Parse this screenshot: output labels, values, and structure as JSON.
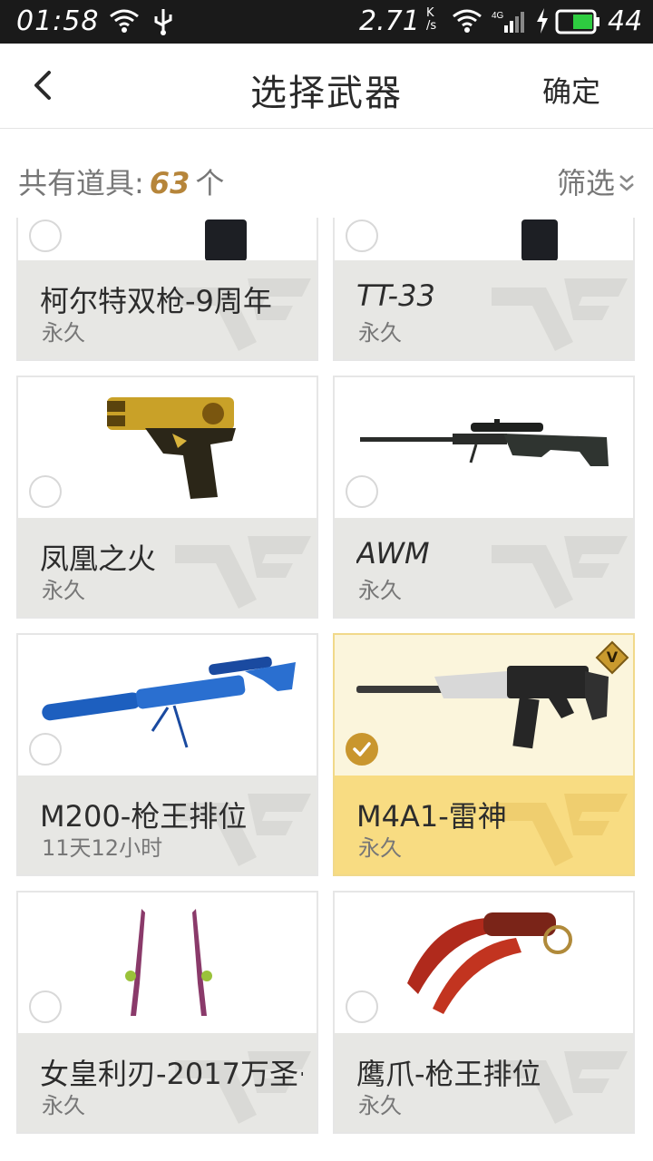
{
  "status_bar": {
    "time": "01:58",
    "speed": "2.71",
    "speed_unit_top": "K",
    "speed_unit_bottom": "/s",
    "network": "4G",
    "battery": "44",
    "icons": [
      "wifi-icon",
      "usb-icon",
      "wifi-icon",
      "signal-icon",
      "charging-icon",
      "battery-icon"
    ]
  },
  "header": {
    "title": "选择武器",
    "confirm_label": "确定",
    "back_icon": "back-arrow-icon"
  },
  "filter_bar": {
    "count_prefix": "共有道具:",
    "count_value": "63",
    "count_suffix": "个",
    "filter_label": "筛选",
    "filter_icon": "chevron-down-icon"
  },
  "items": [
    {
      "name": "柯尔特双枪-9周年",
      "duration": "永久",
      "image": "pistol-icon",
      "selected": false
    },
    {
      "name": "TT-33",
      "duration": "永久",
      "image": "pistol-icon",
      "selected": false
    },
    {
      "name": "凤凰之火",
      "duration": "永久",
      "image": "gold-pistol-icon",
      "selected": false
    },
    {
      "name": "AWM",
      "duration": "永久",
      "image": "sniper-rifle-icon",
      "selected": false
    },
    {
      "name": "M200-枪王排位",
      "duration": "11天12小时",
      "image": "blue-sniper-rifle-icon",
      "selected": false
    },
    {
      "name": "M4A1-雷神",
      "duration": "永久",
      "image": "assault-rifle-icon",
      "selected": true,
      "badge": "V"
    },
    {
      "name": "女皇利刃-2017万圣··",
      "duration": "永久",
      "image": "twin-daggers-icon",
      "selected": false
    },
    {
      "name": "鹰爪-枪王排位",
      "duration": "永久",
      "image": "karambit-icon",
      "selected": false
    }
  ],
  "colors": {
    "accent": "#c9962e",
    "selected_background": "#f8dc82",
    "card_info_background": "#e7e7e4",
    "count_number": "#b6853a"
  }
}
